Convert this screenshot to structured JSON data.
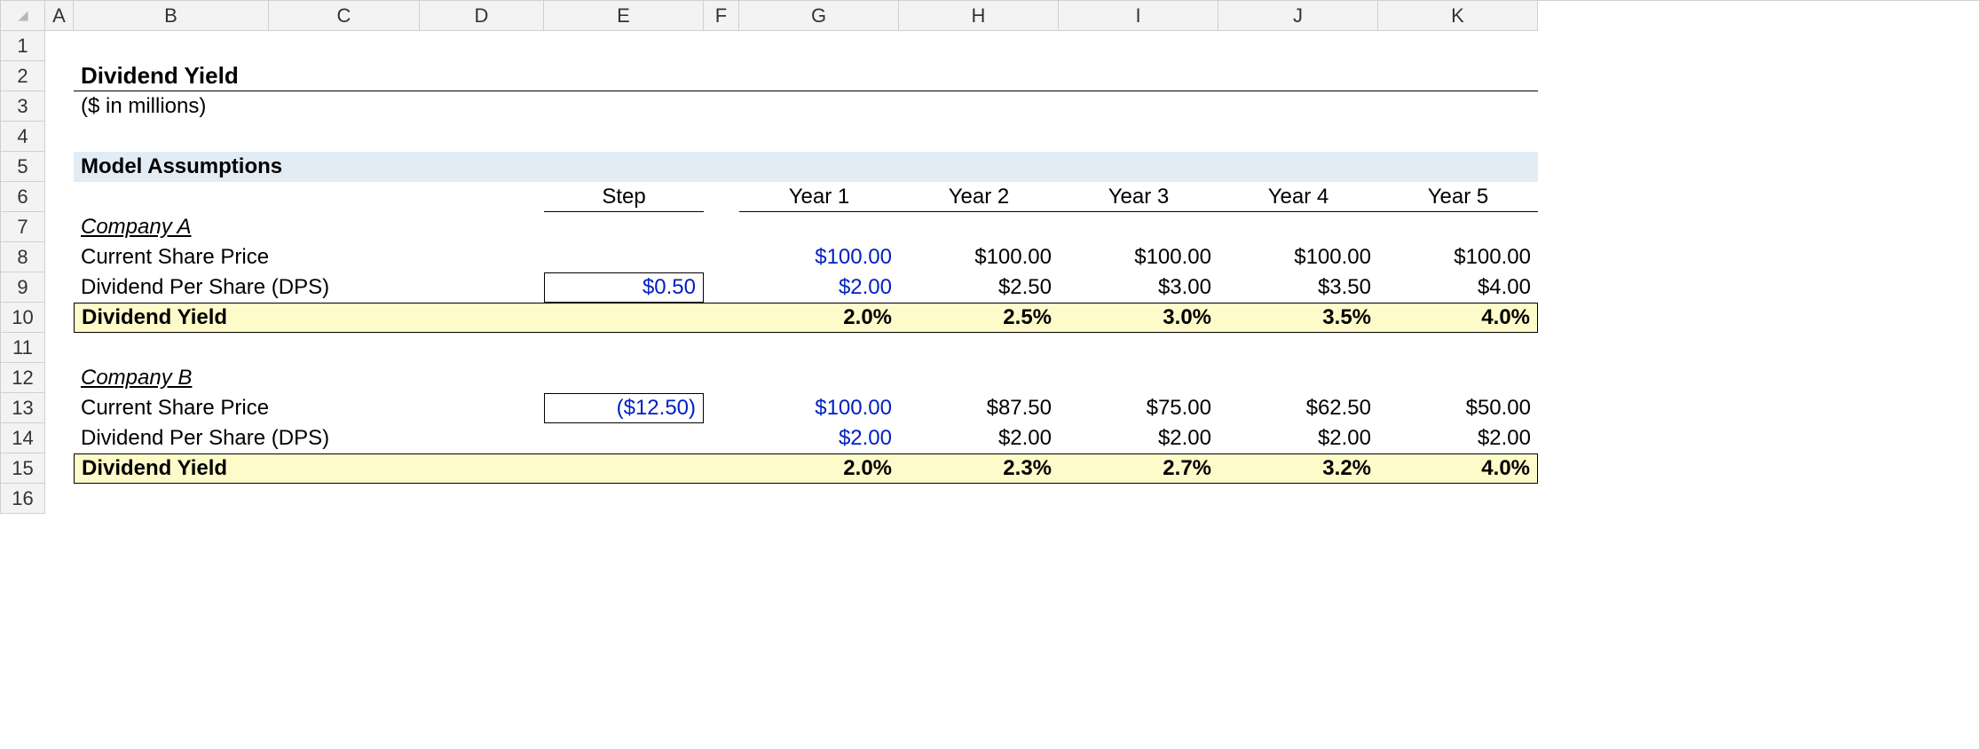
{
  "columns": [
    "A",
    "B",
    "C",
    "D",
    "E",
    "F",
    "G",
    "H",
    "I",
    "J",
    "K"
  ],
  "numRows": 16,
  "title": "Dividend Yield",
  "subtitle": "($ in millions)",
  "sectionHeader": "Model Assumptions",
  "colHeaders": {
    "step": "Step",
    "y1": "Year 1",
    "y2": "Year 2",
    "y3": "Year 3",
    "y4": "Year 4",
    "y5": "Year 5"
  },
  "labels": {
    "companyA": "Company A",
    "companyB": "Company B",
    "csp": "Current Share Price",
    "dps": "Dividend Per Share (DPS)",
    "dy": "Dividend Yield"
  },
  "companyA": {
    "step": "$0.50",
    "csp": [
      "$100.00",
      "$100.00",
      "$100.00",
      "$100.00",
      "$100.00"
    ],
    "dps": [
      "$2.00",
      "$2.50",
      "$3.00",
      "$3.50",
      "$4.00"
    ],
    "dy": [
      "2.0%",
      "2.5%",
      "3.0%",
      "3.5%",
      "4.0%"
    ]
  },
  "companyB": {
    "step": "($12.50)",
    "csp": [
      "$100.00",
      "$87.50",
      "$75.00",
      "$62.50",
      "$50.00"
    ],
    "dps": [
      "$2.00",
      "$2.00",
      "$2.00",
      "$2.00",
      "$2.00"
    ],
    "dy": [
      "2.0%",
      "2.3%",
      "2.7%",
      "3.2%",
      "4.0%"
    ]
  }
}
